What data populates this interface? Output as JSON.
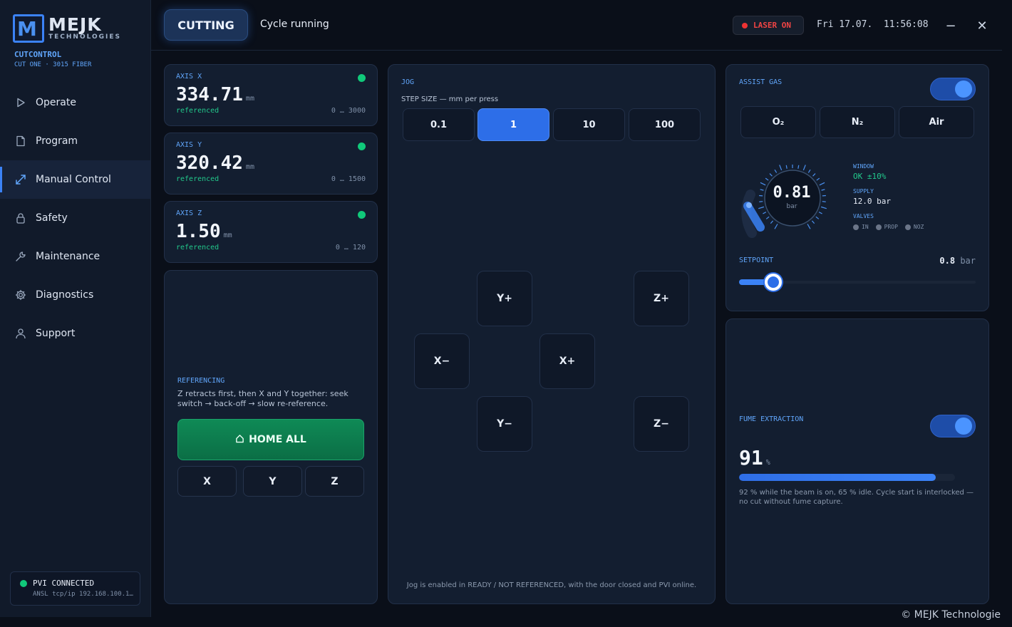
{
  "brand": {
    "mark": "M",
    "name": "MEJK",
    "sub": "TECHNOLOGIES",
    "app": "CUTCONTROL",
    "machine": "CUT ONE · 3015 FIBER"
  },
  "nav": {
    "items": [
      {
        "label": "Operate",
        "icon": "play-icon"
      },
      {
        "label": "Program",
        "icon": "file-icon"
      },
      {
        "label": "Manual Control",
        "icon": "expand-arrows-icon",
        "active": true
      },
      {
        "label": "Safety",
        "icon": "lock-icon"
      },
      {
        "label": "Maintenance",
        "icon": "wrench-icon"
      },
      {
        "label": "Diagnostics",
        "icon": "gear-icon"
      },
      {
        "label": "Support",
        "icon": "user-icon"
      }
    ]
  },
  "connection": {
    "title": "PVI CONNECTED",
    "detail": "ANSL tcp/ip 192.168.100.1…",
    "color": "#10c97a"
  },
  "header": {
    "mode": "CUTTING",
    "status": "Cycle running",
    "laser": "LASER ON",
    "datetime": "Fri 17.07.  11:56:08",
    "minimize": "−",
    "close": "✕"
  },
  "axes": [
    {
      "label": "AXIS X",
      "value": "334.71",
      "unit": "mm",
      "status": "referenced",
      "range": "0 … 3000"
    },
    {
      "label": "AXIS Y",
      "value": "320.42",
      "unit": "mm",
      "status": "referenced",
      "range": "0 … 1500"
    },
    {
      "label": "AXIS Z",
      "value": "1.50",
      "unit": "mm",
      "status": "referenced",
      "range": "0 … 120"
    }
  ],
  "referencing": {
    "title": "REFERENCING",
    "description": "Z retracts first, then X and Y together: seek switch → back-off → slow re-reference.",
    "home_all": "HOME ALL",
    "axis_buttons": [
      "X",
      "Y",
      "Z"
    ]
  },
  "jog": {
    "title": "JOG",
    "step_label": "STEP SIZE — mm per press",
    "steps": [
      "0.1",
      "1",
      "10",
      "100"
    ],
    "selected_step": "1",
    "buttons": {
      "y_plus": "Y+",
      "x_minus": "X−",
      "x_plus": "X+",
      "y_minus": "Y−",
      "z_plus": "Z+",
      "z_minus": "Z−"
    },
    "note": "Jog is enabled in READY / NOT REFERENCED, with the door closed and PVI online."
  },
  "assist_gas": {
    "title": "ASSIST GAS",
    "enabled": true,
    "gases": [
      "O₂",
      "N₂",
      "Air"
    ],
    "gauge_value": "0.81",
    "gauge_unit": "bar",
    "window_label": "WINDOW",
    "window_value": "OK ±10%",
    "supply_label": "SUPPLY",
    "supply_value": "12.0 bar",
    "valves_label": "VALVES",
    "valves": [
      "IN",
      "PROP",
      "NOZ"
    ],
    "setpoint_label": "SETPOINT",
    "setpoint_value": "0.8",
    "setpoint_unit": "bar",
    "setpoint_fraction": 0.145
  },
  "fume_extraction": {
    "title": "FUME EXTRACTION",
    "enabled": true,
    "value": "91",
    "unit": "%",
    "level": 91,
    "description": "92 % while the beam is on, 65 % idle. Cycle start is interlocked — no cut without fume capture."
  },
  "footer": "© MEJK Technologie"
}
